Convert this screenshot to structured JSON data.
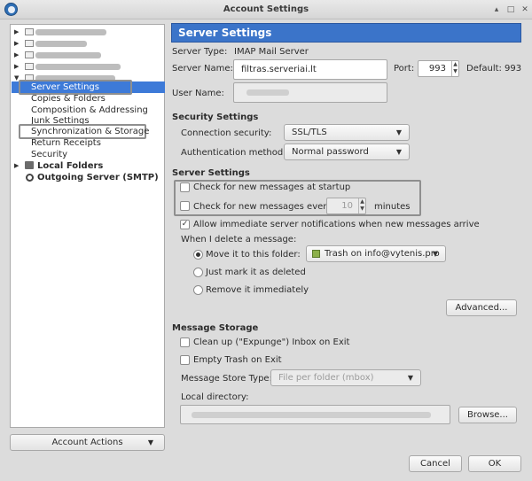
{
  "window": {
    "title": "Account Settings"
  },
  "sidebar": {
    "items": [
      {
        "label": "Server Settings",
        "selected": true
      },
      {
        "label": "Copies & Folders"
      },
      {
        "label": "Composition & Addressing"
      },
      {
        "label": "Junk Settings"
      },
      {
        "label": "Synchronization & Storage"
      },
      {
        "label": "Return Receipts"
      },
      {
        "label": "Security"
      }
    ],
    "local_folders": "Local Folders",
    "outgoing_server": "Outgoing Server (SMTP)",
    "account_actions": "Account Actions"
  },
  "main": {
    "header": "Server Settings",
    "server_type_label": "Server Type:",
    "server_type_value": "IMAP Mail Server",
    "server_name_label": "Server Name:",
    "server_name_value": "filtras.serveriai.lt",
    "port_label": "Port:",
    "port_value": "993",
    "default_label": "Default:",
    "default_value": "993",
    "user_name_label": "User Name:",
    "security_section": "Security Settings",
    "connection_security_label": "Connection security:",
    "connection_security_value": "SSL/TLS",
    "auth_method_label": "Authentication method:",
    "auth_method_value": "Normal password",
    "server_section": "Server Settings",
    "check_startup_label": "Check for new messages at startup",
    "check_every_label": "Check for new messages every",
    "check_every_value": "10",
    "minutes_label": "minutes",
    "allow_push_label": "Allow immediate server notifications when new messages arrive",
    "delete_label": "When I delete a message:",
    "move_label": "Move it to this folder:",
    "trash_folder_value": "Trash on info@vytenis.pro",
    "mark_deleted_label": "Just mark it as deleted",
    "remove_label": "Remove it immediately",
    "advanced_button": "Advanced...",
    "storage_section": "Message Storage",
    "cleanup_label": "Clean up (\"Expunge\") Inbox on Exit",
    "empty_trash_label": "Empty Trash on Exit",
    "store_type_label": "Message Store Type:",
    "store_type_value": "File per folder (mbox)",
    "local_dir_label": "Local directory:",
    "browse_button": "Browse...",
    "cancel_button": "Cancel",
    "ok_button": "OK"
  },
  "colors": {
    "accent": "#3b74c9",
    "selection": "#3d7ad8"
  }
}
